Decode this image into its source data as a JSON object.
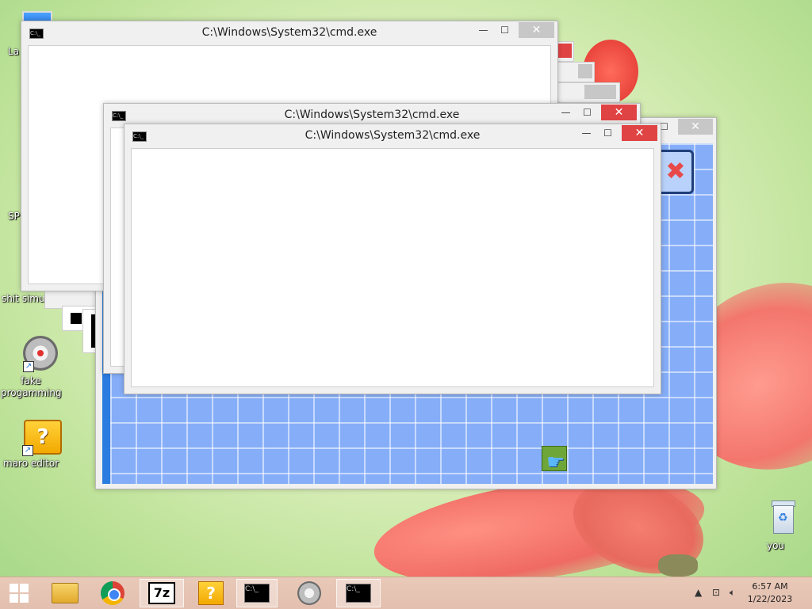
{
  "desktop": {
    "icons": [
      {
        "label": "La",
        "name": "computer-icon"
      },
      {
        "label": "",
        "name": "tools-icon"
      },
      {
        "label": "SP",
        "name": "chrome-like-icon"
      },
      {
        "label": "shit simul",
        "name": "pink-app-icon"
      },
      {
        "label": "fake progamming",
        "name": "fake-programming-icon"
      },
      {
        "label": "maro editor",
        "name": "question-block-icon"
      },
      {
        "label": "you",
        "name": "recycle-bin-icon"
      }
    ]
  },
  "windows": {
    "cmd_back": {
      "title": "C:\\Windows\\System32\\cmd.exe"
    },
    "cmd_middle": {
      "title": "C:\\Windows\\System32\\cmd.exe"
    },
    "cmd_front": {
      "title": "C:\\Windows\\System32\\cmd.exe"
    }
  },
  "controls": {
    "minimize": "—",
    "maximize": "☐",
    "close": "✕"
  },
  "taskbar": {
    "items": [
      {
        "name": "start-button"
      },
      {
        "name": "file-explorer"
      },
      {
        "name": "chrome"
      },
      {
        "name": "7zip",
        "label": "7z"
      },
      {
        "name": "maro-editor",
        "label": "?"
      },
      {
        "name": "cmd-1",
        "label": "C:\\_"
      },
      {
        "name": "fake-programming"
      },
      {
        "name": "cmd-2",
        "label": "C:\\_"
      }
    ],
    "time": "6:57 AM",
    "date": "1/22/2023"
  },
  "colors": {
    "taskbar": "#e3bfaf",
    "grid_blue": "#86aef8",
    "close_red": "#e04343"
  }
}
